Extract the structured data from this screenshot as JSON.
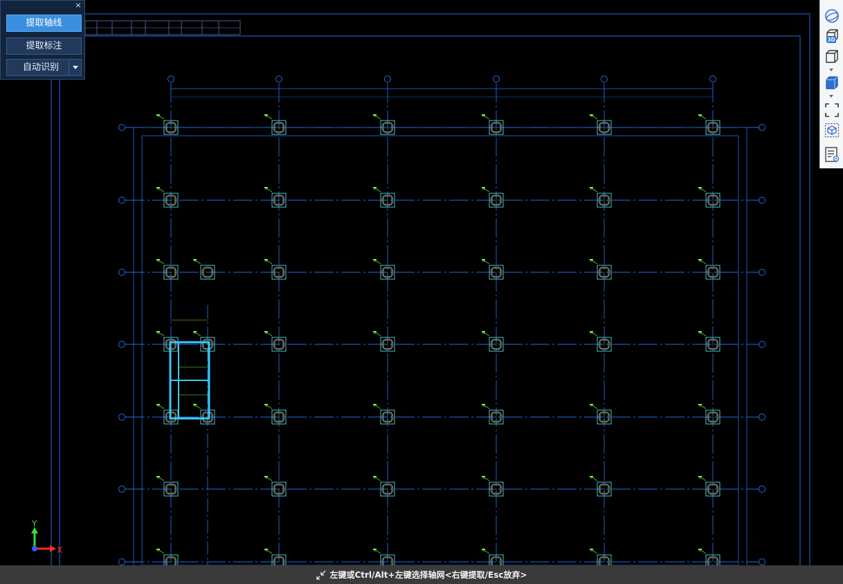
{
  "panel": {
    "close": "×",
    "extract_axis_label": "提取轴线",
    "extract_annotation_label": "提取标注",
    "auto_recognize_label": "自动识别"
  },
  "right_toolbar": {
    "icons": [
      "sphere-view-icon",
      "3d-view-icon",
      "wireframe-box-icon",
      "solid-box-icon",
      "fit-view-icon",
      "isolate-icon",
      "layer-list-icon"
    ],
    "view_3d_label": "3D"
  },
  "status_bar": {
    "hint": "左键或Ctrl/Alt+左键选择轴网<右键提取/Esc放弃>"
  },
  "ucs": {
    "y_label": "Y",
    "x_label": "X"
  },
  "drawing": {
    "colors": {
      "axis": "#1f6fe6",
      "column": "#35d0d0",
      "rebar": "#ff5fd1",
      "label": "#7cff3d",
      "beam": "#3ac7ff"
    }
  }
}
